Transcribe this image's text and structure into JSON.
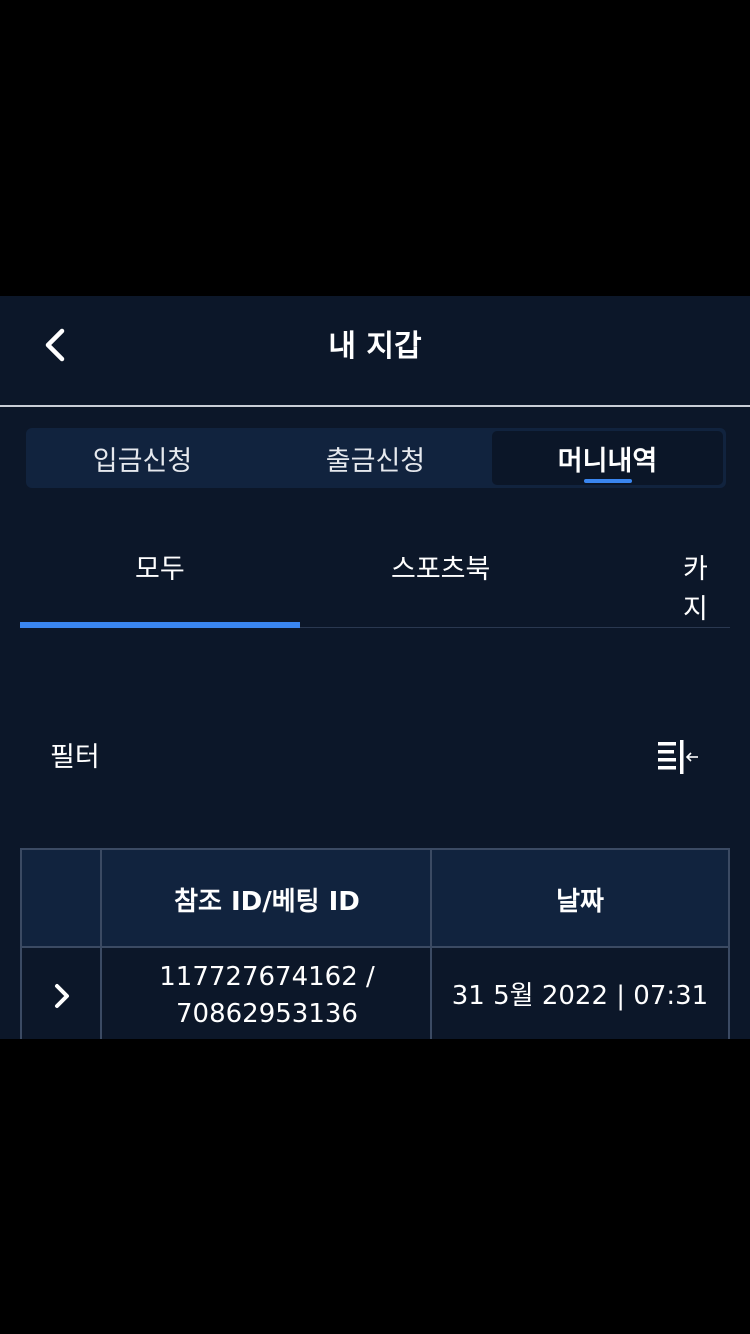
{
  "header": {
    "title": "내 지갑"
  },
  "segment_tabs": [
    {
      "label": "입금신청"
    },
    {
      "label": "출금신청"
    },
    {
      "label": "머니내역",
      "active": true
    }
  ],
  "category_tabs": [
    {
      "label": "모두",
      "active": true
    },
    {
      "label": "스포츠북"
    },
    {
      "label": "카지"
    }
  ],
  "filter": {
    "label": "필터"
  },
  "table": {
    "columns": [
      "",
      "참조 ID/베팅 ID",
      "날짜"
    ],
    "rows": [
      {
        "ref_id": "117727674162 /",
        "bet_id": "70862953136",
        "date": "31 5월 2022 | 07:31"
      }
    ]
  },
  "colors": {
    "background": "#0c1729",
    "accent": "#3a86f0",
    "panel": "#11233e"
  }
}
